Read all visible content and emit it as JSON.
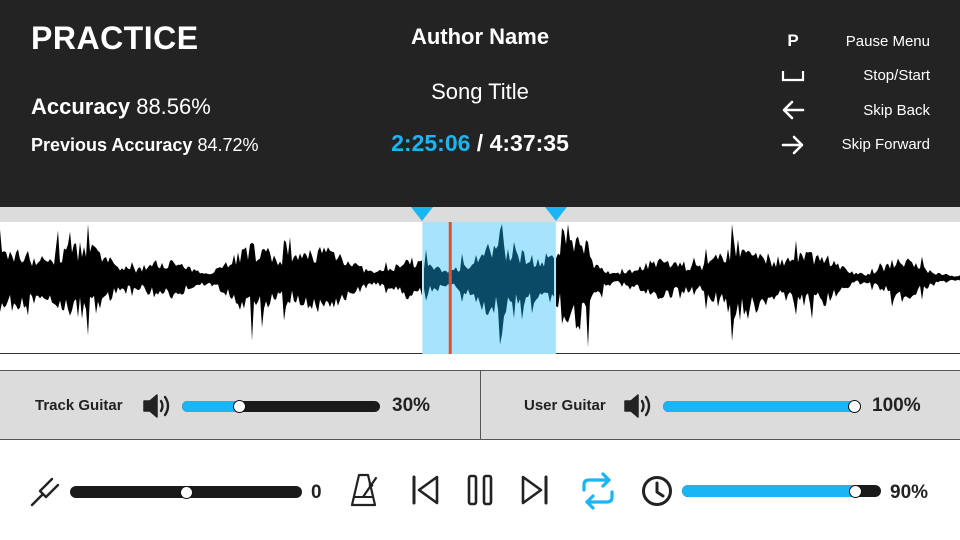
{
  "header": {
    "mode": "PRACTICE",
    "accuracy_label": "Accuracy",
    "accuracy_value": "88.56%",
    "previous_label": "Previous Accuracy",
    "previous_value": "84.72%",
    "author": "Author Name",
    "song": "Song Title",
    "current_time": "2:25:06",
    "separator": "/",
    "total_time": "4:37:35"
  },
  "shortcuts": [
    {
      "key": "P",
      "label": "Pause Menu",
      "icon": "p-key"
    },
    {
      "key": "",
      "label": "Stop/Start",
      "icon": "space-bar-icon"
    },
    {
      "key": "",
      "label": "Skip Back",
      "icon": "arrow-left-icon"
    },
    {
      "key": "",
      "label": "Skip Forward",
      "icon": "arrow-right-icon"
    }
  ],
  "waveform": {
    "loop_start": 0.44,
    "loop_end": 0.579,
    "playhead": 0.469
  },
  "volumes": {
    "track": {
      "label": "Track Guitar",
      "percent": "30%",
      "fraction": 0.29
    },
    "user": {
      "label": "User Guitar",
      "percent": "100%",
      "fraction": 1.0
    }
  },
  "controls": {
    "tuning_value": "0",
    "tuning_fraction": 0.5,
    "speed_value": "90%",
    "speed_fraction": 0.87
  },
  "colors": {
    "accent": "#19b5f5",
    "loop_highlight": "#a6e4fb",
    "loop_inner": "#0b4a66",
    "playhead": "#e0522a",
    "header_bg": "#232323",
    "panel_bg": "#dcdcdc"
  }
}
